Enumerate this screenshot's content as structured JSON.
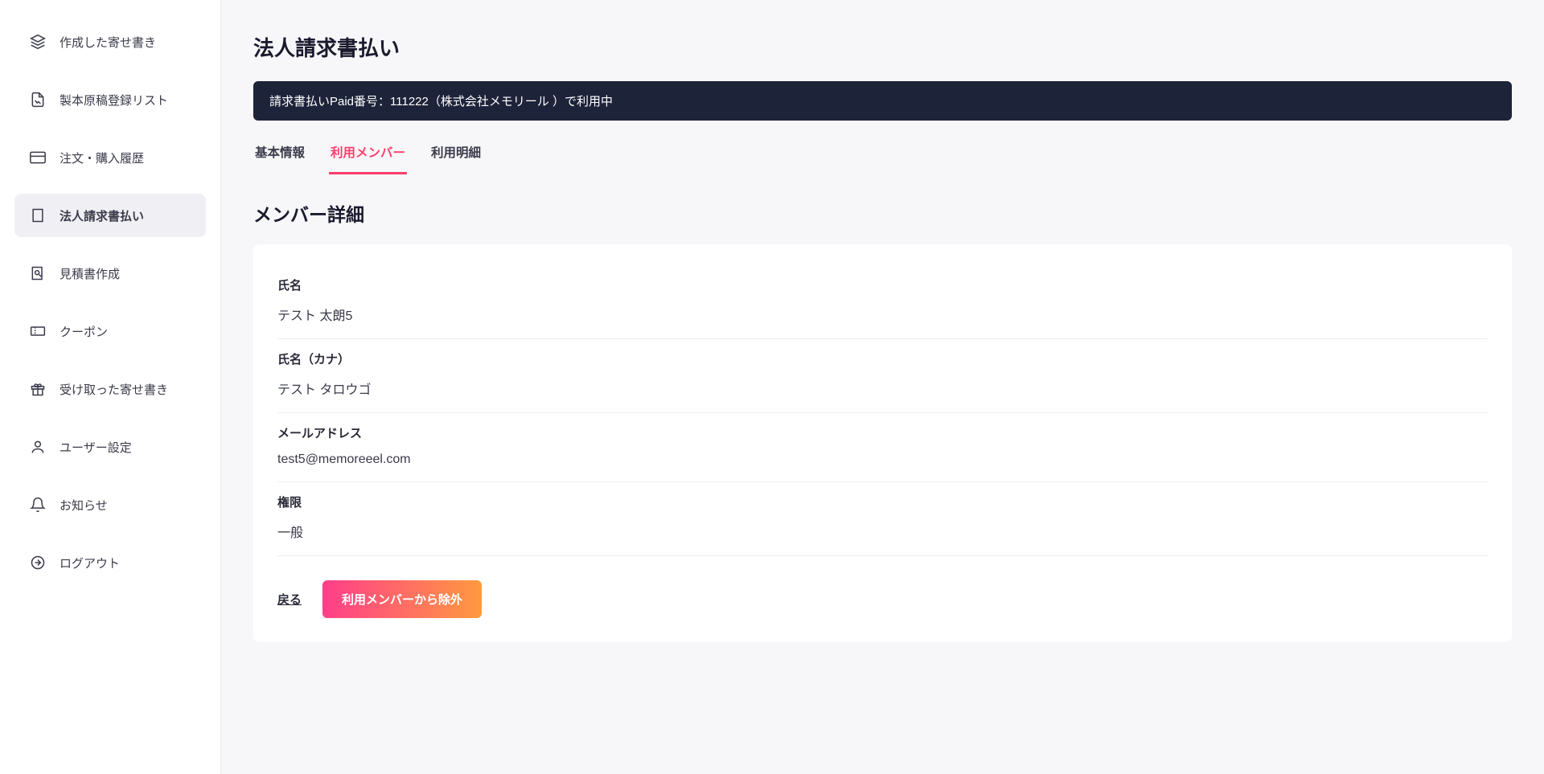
{
  "sidebar": {
    "items": [
      {
        "label": "作成した寄せ書き"
      },
      {
        "label": "製本原稿登録リスト"
      },
      {
        "label": "注文・購入履歴"
      },
      {
        "label": "法人請求書払い"
      },
      {
        "label": "見積書作成"
      },
      {
        "label": "クーポン"
      },
      {
        "label": "受け取った寄せ書き"
      },
      {
        "label": "ユーザー設定"
      },
      {
        "label": "お知らせ"
      },
      {
        "label": "ログアウト"
      }
    ]
  },
  "page": {
    "title": "法人請求書払い",
    "status": "請求書払いPaid番号：111222（株式会社メモリール ）で利用中"
  },
  "tabs": [
    {
      "label": "基本情報"
    },
    {
      "label": "利用メンバー"
    },
    {
      "label": "利用明細"
    }
  ],
  "section_title": "メンバー詳細",
  "member": {
    "name_label": "氏名",
    "name_value": "テスト 太朗5",
    "kana_label": "氏名（カナ）",
    "kana_value": "テスト タロウゴ",
    "email_label": "メールアドレス",
    "email_value": "test5@memoreeel.com",
    "role_label": "権限",
    "role_value": "一般"
  },
  "actions": {
    "back": "戻る",
    "remove": "利用メンバーから除外"
  }
}
